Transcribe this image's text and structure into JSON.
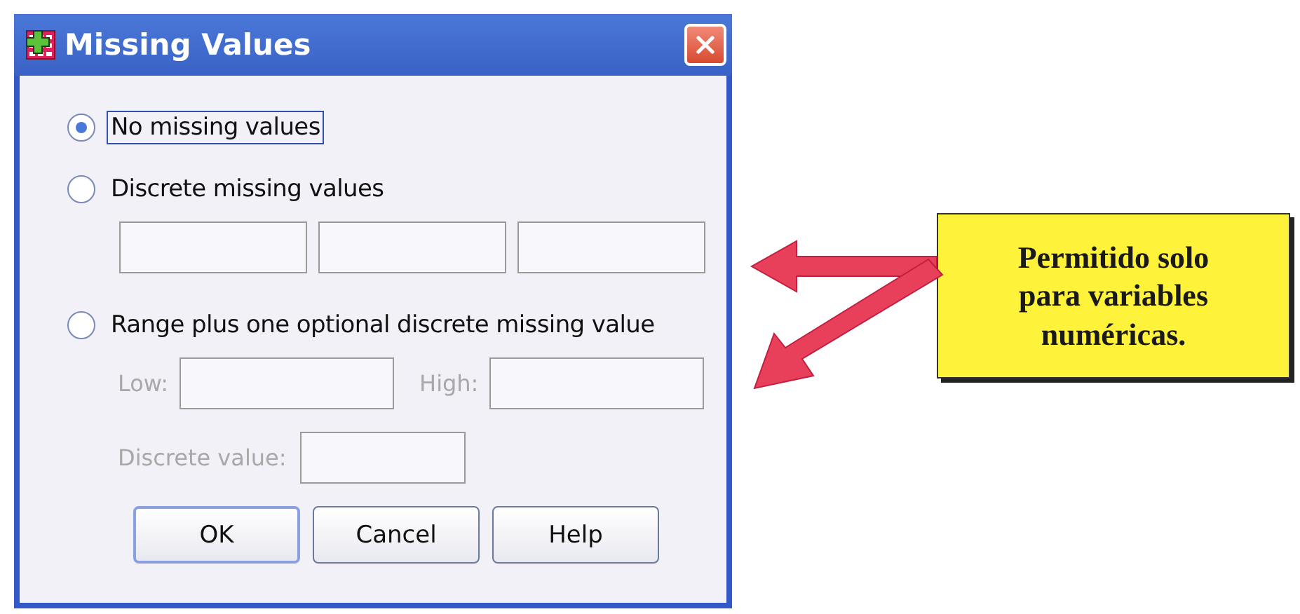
{
  "window": {
    "title": "Missing Values"
  },
  "options": [
    {
      "label": "No missing values",
      "selected": true
    },
    {
      "label": "Discrete missing values",
      "selected": false
    },
    {
      "label": "Range plus one optional discrete missing value",
      "selected": false
    }
  ],
  "discrete_fields": [
    {
      "disabled": true
    },
    {
      "disabled": true
    },
    {
      "disabled": true
    }
  ],
  "range_fields": [
    {
      "label": "Low:",
      "disabled": true
    },
    {
      "label": "High:",
      "disabled": true
    }
  ],
  "discrete_value_field": {
    "label": "Discrete value:",
    "disabled": true
  },
  "buttons": [
    {
      "label": "OK",
      "default": true
    },
    {
      "label": "Cancel",
      "default": false
    },
    {
      "label": "Help",
      "default": false
    }
  ],
  "callout": {
    "text": "Permitido solo\npara variables\nnuméricas."
  }
}
